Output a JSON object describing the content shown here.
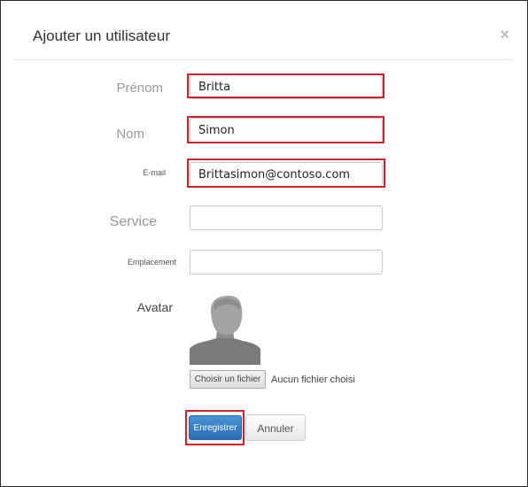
{
  "dialog": {
    "title": "Ajouter un utilisateur",
    "close_symbol": "×"
  },
  "form": {
    "first_name": {
      "label": "Prénom",
      "value": "Britta"
    },
    "last_name": {
      "label": "Nom",
      "value": "Simon"
    },
    "email": {
      "label": "E-mail",
      "value": "Brittasimon@contoso.com"
    },
    "department": {
      "label": "Service",
      "value": ""
    },
    "location": {
      "label": "Emplacement",
      "value": ""
    },
    "avatar": {
      "label": "Avatar",
      "file_button_label": "Choisir un fichier",
      "file_status": "Aucun fichier choisi"
    }
  },
  "actions": {
    "save_label": "Enregistrer",
    "cancel_label": "Annuler"
  },
  "colors": {
    "highlight": "#d3202a",
    "primary": "#2b6db5"
  },
  "icons": [
    "close-icon",
    "avatar-placeholder-icon"
  ]
}
